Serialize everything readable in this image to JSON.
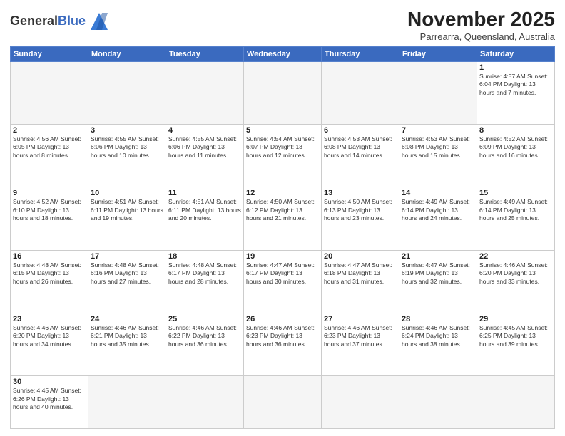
{
  "header": {
    "logo_general": "General",
    "logo_blue": "Blue",
    "month_title": "November 2025",
    "subtitle": "Parrearra, Queensland, Australia"
  },
  "days_of_week": [
    "Sunday",
    "Monday",
    "Tuesday",
    "Wednesday",
    "Thursday",
    "Friday",
    "Saturday"
  ],
  "weeks": [
    [
      {
        "day": "",
        "info": ""
      },
      {
        "day": "",
        "info": ""
      },
      {
        "day": "",
        "info": ""
      },
      {
        "day": "",
        "info": ""
      },
      {
        "day": "",
        "info": ""
      },
      {
        "day": "",
        "info": ""
      },
      {
        "day": "1",
        "info": "Sunrise: 4:57 AM\nSunset: 6:04 PM\nDaylight: 13 hours and 7 minutes."
      }
    ],
    [
      {
        "day": "2",
        "info": "Sunrise: 4:56 AM\nSunset: 6:05 PM\nDaylight: 13 hours and 8 minutes."
      },
      {
        "day": "3",
        "info": "Sunrise: 4:55 AM\nSunset: 6:06 PM\nDaylight: 13 hours and 10 minutes."
      },
      {
        "day": "4",
        "info": "Sunrise: 4:55 AM\nSunset: 6:06 PM\nDaylight: 13 hours and 11 minutes."
      },
      {
        "day": "5",
        "info": "Sunrise: 4:54 AM\nSunset: 6:07 PM\nDaylight: 13 hours and 12 minutes."
      },
      {
        "day": "6",
        "info": "Sunrise: 4:53 AM\nSunset: 6:08 PM\nDaylight: 13 hours and 14 minutes."
      },
      {
        "day": "7",
        "info": "Sunrise: 4:53 AM\nSunset: 6:08 PM\nDaylight: 13 hours and 15 minutes."
      },
      {
        "day": "8",
        "info": "Sunrise: 4:52 AM\nSunset: 6:09 PM\nDaylight: 13 hours and 16 minutes."
      }
    ],
    [
      {
        "day": "9",
        "info": "Sunrise: 4:52 AM\nSunset: 6:10 PM\nDaylight: 13 hours and 18 minutes."
      },
      {
        "day": "10",
        "info": "Sunrise: 4:51 AM\nSunset: 6:11 PM\nDaylight: 13 hours and 19 minutes."
      },
      {
        "day": "11",
        "info": "Sunrise: 4:51 AM\nSunset: 6:11 PM\nDaylight: 13 hours and 20 minutes."
      },
      {
        "day": "12",
        "info": "Sunrise: 4:50 AM\nSunset: 6:12 PM\nDaylight: 13 hours and 21 minutes."
      },
      {
        "day": "13",
        "info": "Sunrise: 4:50 AM\nSunset: 6:13 PM\nDaylight: 13 hours and 23 minutes."
      },
      {
        "day": "14",
        "info": "Sunrise: 4:49 AM\nSunset: 6:14 PM\nDaylight: 13 hours and 24 minutes."
      },
      {
        "day": "15",
        "info": "Sunrise: 4:49 AM\nSunset: 6:14 PM\nDaylight: 13 hours and 25 minutes."
      }
    ],
    [
      {
        "day": "16",
        "info": "Sunrise: 4:48 AM\nSunset: 6:15 PM\nDaylight: 13 hours and 26 minutes."
      },
      {
        "day": "17",
        "info": "Sunrise: 4:48 AM\nSunset: 6:16 PM\nDaylight: 13 hours and 27 minutes."
      },
      {
        "day": "18",
        "info": "Sunrise: 4:48 AM\nSunset: 6:17 PM\nDaylight: 13 hours and 28 minutes."
      },
      {
        "day": "19",
        "info": "Sunrise: 4:47 AM\nSunset: 6:17 PM\nDaylight: 13 hours and 30 minutes."
      },
      {
        "day": "20",
        "info": "Sunrise: 4:47 AM\nSunset: 6:18 PM\nDaylight: 13 hours and 31 minutes."
      },
      {
        "day": "21",
        "info": "Sunrise: 4:47 AM\nSunset: 6:19 PM\nDaylight: 13 hours and 32 minutes."
      },
      {
        "day": "22",
        "info": "Sunrise: 4:46 AM\nSunset: 6:20 PM\nDaylight: 13 hours and 33 minutes."
      }
    ],
    [
      {
        "day": "23",
        "info": "Sunrise: 4:46 AM\nSunset: 6:20 PM\nDaylight: 13 hours and 34 minutes."
      },
      {
        "day": "24",
        "info": "Sunrise: 4:46 AM\nSunset: 6:21 PM\nDaylight: 13 hours and 35 minutes."
      },
      {
        "day": "25",
        "info": "Sunrise: 4:46 AM\nSunset: 6:22 PM\nDaylight: 13 hours and 36 minutes."
      },
      {
        "day": "26",
        "info": "Sunrise: 4:46 AM\nSunset: 6:23 PM\nDaylight: 13 hours and 36 minutes."
      },
      {
        "day": "27",
        "info": "Sunrise: 4:46 AM\nSunset: 6:23 PM\nDaylight: 13 hours and 37 minutes."
      },
      {
        "day": "28",
        "info": "Sunrise: 4:46 AM\nSunset: 6:24 PM\nDaylight: 13 hours and 38 minutes."
      },
      {
        "day": "29",
        "info": "Sunrise: 4:45 AM\nSunset: 6:25 PM\nDaylight: 13 hours and 39 minutes."
      }
    ],
    [
      {
        "day": "30",
        "info": "Sunrise: 4:45 AM\nSunset: 6:26 PM\nDaylight: 13 hours and 40 minutes."
      },
      {
        "day": "",
        "info": ""
      },
      {
        "day": "",
        "info": ""
      },
      {
        "day": "",
        "info": ""
      },
      {
        "day": "",
        "info": ""
      },
      {
        "day": "",
        "info": ""
      },
      {
        "day": "",
        "info": ""
      }
    ]
  ]
}
